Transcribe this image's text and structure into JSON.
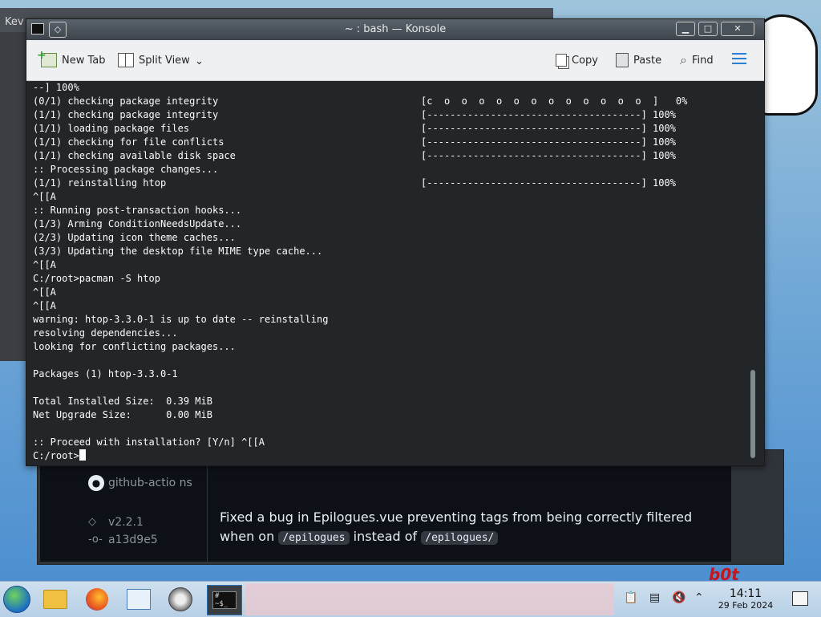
{
  "desktop": {
    "background_app_title": "Kev",
    "release": {
      "author": "github-actio ns",
      "tag": "v2.2.1",
      "commit": "a13d9e5",
      "notes_before": "Fixed a bug in Epilogues.vue preventing tags from being correctly filtered when on ",
      "code1": "/epilogues",
      "notes_middle": " instead of ",
      "code2": "/epilogues/"
    },
    "corner_text": "b0t"
  },
  "konsole": {
    "title": "~ : bash — Konsole",
    "toolbar": {
      "new_tab": "New Tab",
      "split_view": "Split View",
      "copy": "Copy",
      "paste": "Paste",
      "find": "Find"
    },
    "terminal": {
      "lines": [
        "--] 100%",
        "(0/1) checking package integrity                                   [c  o  o  o  o  o  o  o  o  o  o  o  o  ]   0%",
        "(1/1) checking package integrity                                   [-------------------------------------] 100%",
        "(1/1) loading package files                                        [-------------------------------------] 100%",
        "(1/1) checking for file conflicts                                  [-------------------------------------] 100%",
        "(1/1) checking available disk space                                [-------------------------------------] 100%",
        ":: Processing package changes...",
        "(1/1) reinstalling htop                                            [-------------------------------------] 100%",
        "^[[A",
        ":: Running post-transaction hooks...",
        "(1/3) Arming ConditionNeedsUpdate...",
        "(2/3) Updating icon theme caches...",
        "(3/3) Updating the desktop file MIME type cache...",
        "^[[A",
        "C:/root>pacman -S htop",
        "^[[A",
        "^[[A",
        "warning: htop-3.3.0-1 is up to date -- reinstalling",
        "resolving dependencies...",
        "looking for conflicting packages...",
        "",
        "Packages (1) htop-3.3.0-1",
        "",
        "Total Installed Size:  0.39 MiB",
        "Net Upgrade Size:      0.00 MiB",
        "",
        ":: Proceed with installation? [Y/n] ^[[A"
      ],
      "prompt": "C:/root>"
    }
  },
  "taskbar": {
    "konsole_thumb": "# ~$_",
    "clock_time": "14:11",
    "clock_date": "29 Feb 2024"
  }
}
